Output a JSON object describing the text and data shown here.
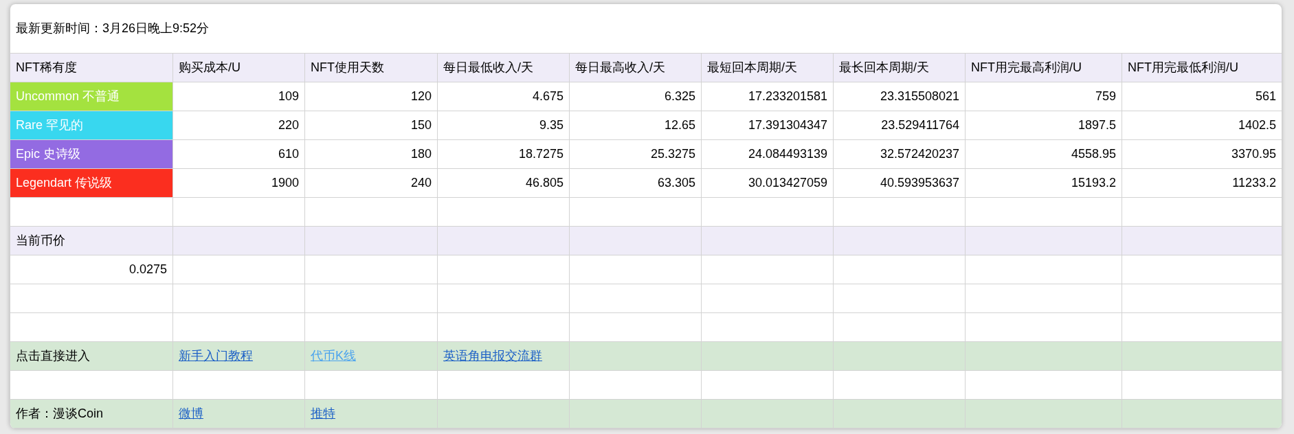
{
  "update_time": "最新更新时间：3月26日晚上9:52分",
  "table": {
    "columns": [
      "NFT稀有度",
      "购买成本/U",
      "NFT使用天数",
      "每日最低收入/天",
      "每日最高收入/天",
      "最短回本周期/天",
      "最长回本周期/天",
      "NFT用完最高利润/U",
      "NFT用完最低利润/U"
    ],
    "rows": [
      {
        "color": "#a4e23f",
        "cells": [
          "Uncommon 不普通",
          "109",
          "120",
          "4.675",
          "6.325",
          "17.233201581",
          "23.315508021",
          "759",
          "561"
        ]
      },
      {
        "color": "#38d7ef",
        "cells": [
          "Rare 罕见的",
          "220",
          "150",
          "9.35",
          "12.65",
          "17.391304347",
          "23.529411764",
          "1897.5",
          "1402.5"
        ]
      },
      {
        "color": "#936be2",
        "cells": [
          "Epic 史诗级",
          "610",
          "180",
          "18.7275",
          "25.3275",
          "24.084493139",
          "32.572420237",
          "4558.95",
          "3370.95"
        ]
      },
      {
        "color": "#fb2e1f",
        "cells": [
          "Legendart 传说级",
          "1900",
          "240",
          "46.805",
          "63.305",
          "30.013427059",
          "40.593953637",
          "15193.2",
          "11233.2"
        ]
      }
    ]
  },
  "price_section": {
    "label": "当前币价",
    "value": "0.0275"
  },
  "links_row": {
    "label": "点击直接进入",
    "links": [
      {
        "text": "新手入门教程",
        "visited": false
      },
      {
        "text": "代币K线",
        "visited": true
      },
      {
        "text": "英语角电报交流群",
        "visited": false
      }
    ]
  },
  "author_row": {
    "label": "作者：漫谈Coin",
    "links": [
      {
        "text": "微博",
        "visited": false
      },
      {
        "text": "推特",
        "visited": false
      }
    ]
  }
}
